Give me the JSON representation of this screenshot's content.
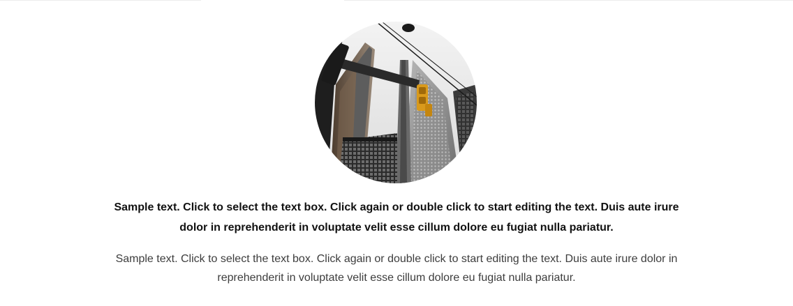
{
  "image": {
    "subject": "city-building-traffic-light-photo"
  },
  "text_block": {
    "heading": "Sample text. Click to select the text box. Click again or double click to start editing the text. Duis aute irure dolor in reprehenderit in voluptate velit esse cillum dolore eu fugiat nulla pariatur.",
    "paragraph": "Sample text. Click to select the text box. Click again or double click to start editing the text. Duis aute irure dolor in reprehenderit in voluptate velit esse cillum dolore eu fugiat nulla pariatur."
  },
  "colors": {
    "background": "#ffffff",
    "heading_text": "#111111",
    "body_text": "#3d3d3d",
    "traffic_light": "#d99a1c"
  }
}
